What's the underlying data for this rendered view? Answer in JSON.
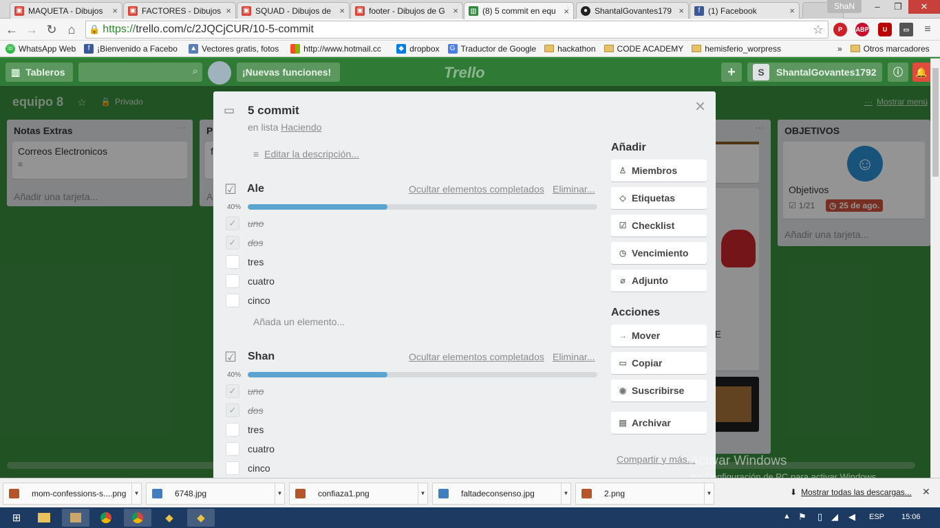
{
  "browser": {
    "tabs": [
      {
        "title": "MAQUETA - Dibujos",
        "icon": "drawings-icon",
        "color": "#d9473b"
      },
      {
        "title": "FACTORES - Dibujos",
        "icon": "drawings-icon",
        "color": "#d9473b"
      },
      {
        "title": "SQUAD - Dibujos de",
        "icon": "drawings-icon",
        "color": "#d9473b"
      },
      {
        "title": "footer - Dibujos de G",
        "icon": "drawings-icon",
        "color": "#d9473b"
      },
      {
        "title": "(8) 5 commit en equ",
        "icon": "trello-icon",
        "color": "#2f8a3a"
      },
      {
        "title": "ShantalGovantes179",
        "icon": "github-icon",
        "color": "#222222"
      },
      {
        "title": "(1) Facebook",
        "icon": "facebook-icon",
        "color": "#3b5998"
      }
    ],
    "user": "ShaN",
    "url_https": "https://",
    "url_rest": "trello.com/c/2JQCjCUR/10-5-commit",
    "bookmarks": [
      "WhatsApp Web",
      "¡Bienvenido a Facebo",
      "Vectores gratis, fotos",
      "http://www.hotmail.cc",
      "dropbox",
      "Traductor de Google",
      "hackathon",
      "CODE ACADEMY",
      "hemisferio_worpress"
    ],
    "bookmarks_more": "»",
    "other_bookmarks": "Otros marcadores"
  },
  "trello": {
    "boards_label": "Tableros",
    "new_features": "¡Nuevas funciones!",
    "logo": "Trello",
    "user_initial": "S",
    "username": "ShantalGovantes1792",
    "board_name": "equipo 8",
    "privacy": "Privado",
    "show_menu": "Mostrar menú",
    "lists": [
      {
        "title": "Notas Extras",
        "cards": [
          "Correos Electronicos"
        ],
        "add": "Añadir una tarjeta..."
      },
      {
        "title": "P",
        "cards": [
          "f"
        ],
        "add": "A"
      },
      {
        "title": "OBJETIVOS",
        "cards": [
          "Objetivos"
        ],
        "badge_checklist": "1/21",
        "badge_due": "25 de ago.",
        "add": "Añadir una tarjeta..."
      }
    ],
    "partial_card_text": "CIO E"
  },
  "card": {
    "title": "5 commit",
    "in_list_prefix": "en lista",
    "list_name": "Haciendo",
    "edit_description": "Editar la descripción...",
    "checklists": [
      {
        "title": "Ale",
        "progress_label": "40%",
        "progress": 0.4,
        "hide_completed": "Ocultar elementos completados",
        "delete": "Eliminar...",
        "items": [
          {
            "text": "uno",
            "done": true
          },
          {
            "text": "dos",
            "done": true
          },
          {
            "text": "tres",
            "done": false
          },
          {
            "text": "cuatro",
            "done": false
          },
          {
            "text": "cinco",
            "done": false
          }
        ],
        "add_item": "Añada un elemento..."
      },
      {
        "title": "Shan",
        "progress_label": "40%",
        "progress": 0.4,
        "hide_completed": "Ocultar elementos completados",
        "delete": "Eliminar...",
        "items": [
          {
            "text": "uno",
            "done": true
          },
          {
            "text": "dos",
            "done": true
          },
          {
            "text": "tres",
            "done": false
          },
          {
            "text": "cuatro",
            "done": false
          },
          {
            "text": "cinco",
            "done": false
          }
        ]
      }
    ],
    "add_heading": "Añadir",
    "add_buttons": [
      {
        "label": "Miembros",
        "icon": "person-icon"
      },
      {
        "label": "Etiquetas",
        "icon": "tag-icon"
      },
      {
        "label": "Checklist",
        "icon": "checkbox-icon"
      },
      {
        "label": "Vencimiento",
        "icon": "clock-icon"
      },
      {
        "label": "Adjunto",
        "icon": "paperclip-icon"
      }
    ],
    "actions_heading": "Acciones",
    "action_buttons": [
      {
        "label": "Mover",
        "icon": "arrow-right-icon"
      },
      {
        "label": "Copiar",
        "icon": "copy-icon"
      },
      {
        "label": "Suscribirse",
        "icon": "eye-icon"
      },
      {
        "label": "Archivar",
        "icon": "archive-icon"
      }
    ],
    "share": "Compartir y más..."
  },
  "watermark": {
    "line1": "Activar Windows",
    "line2": "Ir a Configuración de PC para activar Windows."
  },
  "downloads": {
    "items": [
      "mom-confessions-s....png",
      "6748.jpg",
      "confiaza1.png",
      "faltadeconsenso.jpg",
      "2.png"
    ],
    "show_all": "Mostrar todas las descargas..."
  },
  "taskbar": {
    "lang": "ESP",
    "time": "15:06"
  }
}
